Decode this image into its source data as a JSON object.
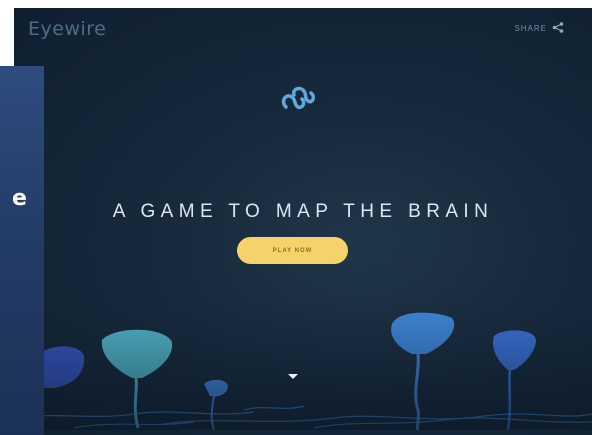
{
  "header": {
    "logo_text": "Eyewire",
    "share_label": "SHARE"
  },
  "hero": {
    "headline": "A GAME TO MAP THE BRAIN",
    "play_button_label": "PLAY NOW"
  },
  "left_panel": {
    "visible_letter": "e"
  },
  "icons": {
    "brand": "eyewire-brand-icon",
    "share": "share-icon",
    "scroll": "chevron-down-icon"
  },
  "colors": {
    "background": "#16283a",
    "accent_button": "#f5d36b",
    "brand_icon": "#5fa8e0",
    "neuron_blue": "#3f86d6",
    "neuron_teal": "#4fb3c6",
    "left_panel": "#223b66"
  }
}
